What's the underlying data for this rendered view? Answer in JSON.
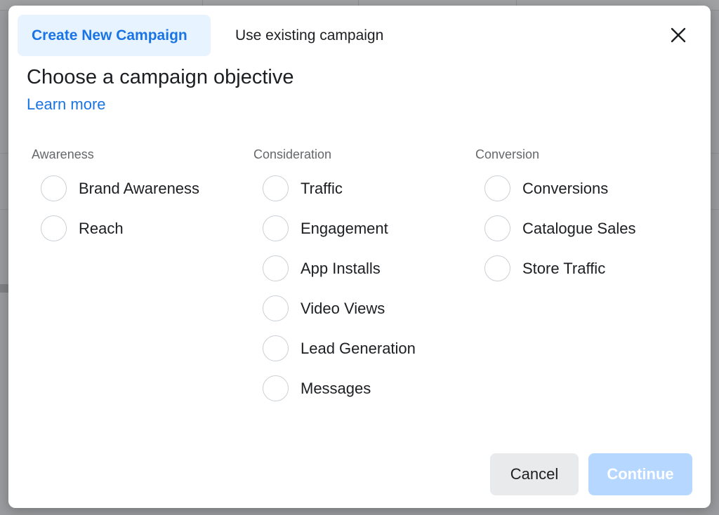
{
  "tabs": {
    "create": "Create New Campaign",
    "existing": "Use existing campaign"
  },
  "title": "Choose a campaign objective",
  "learn_more": "Learn more",
  "groups": [
    {
      "label": "Awareness",
      "options": [
        "Brand Awareness",
        "Reach"
      ]
    },
    {
      "label": "Consideration",
      "options": [
        "Traffic",
        "Engagement",
        "App Installs",
        "Video Views",
        "Lead Generation",
        "Messages"
      ]
    },
    {
      "label": "Conversion",
      "options": [
        "Conversions",
        "Catalogue Sales",
        "Store Traffic"
      ]
    }
  ],
  "buttons": {
    "cancel": "Cancel",
    "continue": "Continue"
  },
  "icons": {
    "close": "close-icon"
  },
  "colors": {
    "accent": "#1b74e4",
    "active_tab_bg": "#e7f3ff",
    "continue_disabled": "#b6d7ff"
  }
}
